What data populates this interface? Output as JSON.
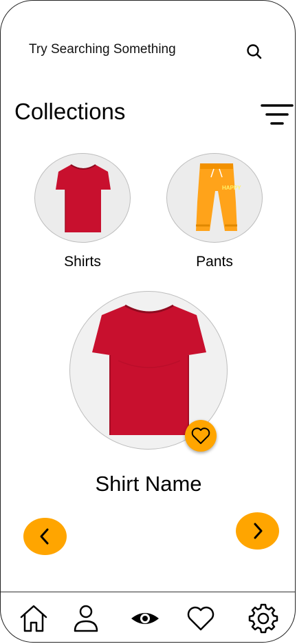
{
  "search": {
    "placeholder_text": "Try Searching Something",
    "icon": "search-icon"
  },
  "collections": {
    "title": "Collections",
    "filter_icon": "filter-icon",
    "categories": [
      {
        "label": "Shirts",
        "image": "red-tshirt"
      },
      {
        "label": "Pants",
        "image": "orange-sweatpants"
      }
    ]
  },
  "featured": {
    "product_name": "Shirt Name",
    "image": "red-tshirt",
    "favorite_icon": "heart-icon",
    "prev_icon": "chevron-left-icon",
    "next_icon": "chevron-right-icon"
  },
  "bottom_nav": {
    "items": [
      {
        "icon": "home-icon"
      },
      {
        "icon": "user-icon"
      },
      {
        "icon": "eye-icon",
        "active": true
      },
      {
        "icon": "heart-icon"
      },
      {
        "icon": "gear-icon"
      }
    ]
  },
  "colors": {
    "accent": "#ffa500",
    "shirt": "#c8102e",
    "pants": "#ffa31a"
  }
}
